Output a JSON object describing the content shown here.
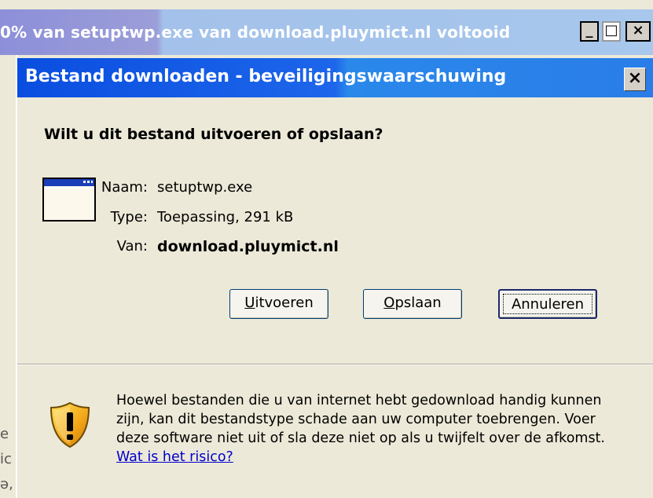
{
  "background_window": {
    "title": "0% van setuptwp.exe van download.pluymict.nl voltooid",
    "controls": {
      "minimize": "_",
      "maximize": "□",
      "close": "×"
    },
    "left_fragments": [
      "e",
      "ic",
      "ə,"
    ]
  },
  "dialog": {
    "title": "Bestand downloaden - beveiligingswaarschuwing",
    "close": "×",
    "question": "Wilt u dit bestand uitvoeren of opslaan?",
    "file": {
      "name_label": "Naam:",
      "name_value": "setuptwp.exe",
      "type_label": "Type:",
      "type_value": "Toepassing, 291 kB",
      "from_label": "Van:",
      "from_value": "download.pluymict.nl"
    },
    "buttons": {
      "run": {
        "accel": "U",
        "rest": "itvoeren"
      },
      "save": {
        "accel": "O",
        "rest": "pslaan"
      },
      "cancel": {
        "label": "Annuleren"
      }
    },
    "warning": {
      "text": "Hoewel bestanden die u van internet hebt gedownload handig kunnen zijn, kan dit bestandstype schade aan uw computer toebrengen. Voer deze software niet uit of sla deze niet op als u twijfelt over de afkomst.",
      "link": "Wat is het risico?"
    }
  },
  "colors": {
    "titlebar_blue": "#0a4ee0",
    "dialog_bg": "#ece9d8",
    "link": "#0000cc"
  },
  "icons": [
    "application-window-icon",
    "security-shield-icon"
  ]
}
